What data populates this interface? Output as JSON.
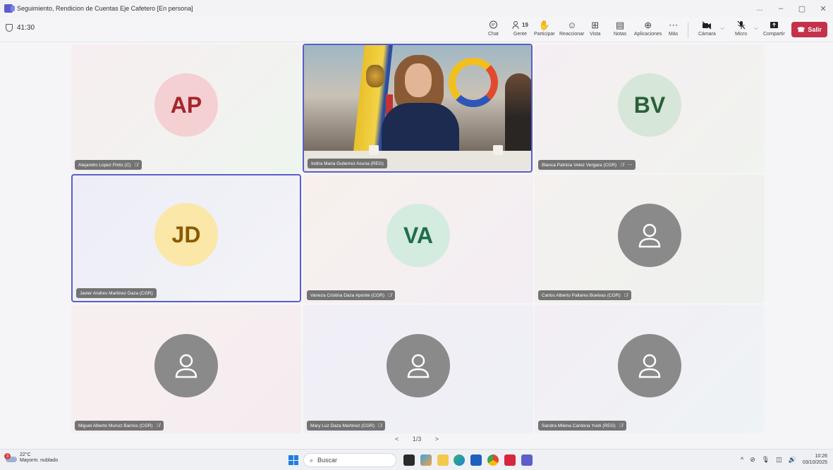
{
  "window": {
    "title": "Seguimiento, Rendicion de Cuentas Eje Cafetero [En persona]",
    "controls": [
      "...",
      "–",
      "▢",
      "✕"
    ]
  },
  "meeting": {
    "timer": "41:30",
    "toolbar": {
      "chat": "Chat",
      "people": "Gente",
      "people_count": "19",
      "raise": "Participar",
      "react": "Reaccionar",
      "view": "Vista",
      "notes": "Notas",
      "apps": "Aplicaciones",
      "more": "Más",
      "camera": "Cámara",
      "mic": "Micro",
      "share": "Compartir",
      "leave": "Salir"
    },
    "leave_color": "#c4314b",
    "accent_color": "#5b5fc7"
  },
  "participants": [
    {
      "name": "Alejandro Lopez Pinto (C)",
      "initials": "AP",
      "avatar_bg": "#f4d0d3",
      "avatar_fg": "#a4262c",
      "tile_bg": "linear-gradient(135deg,#f7eef0,#eef5ef)",
      "muted": true
    },
    {
      "name": "Indira Maria Gutierrez Acuna (REG)",
      "initials": "",
      "video": true,
      "muted": false
    },
    {
      "name": "Blanca Patricia Velez Vergara (CGR)",
      "initials": "BV",
      "avatar_bg": "#d6e6d8",
      "avatar_fg": "#2a5f3a",
      "tile_bg": "linear-gradient(135deg,#f5eef2,#f0f3ee)",
      "muted": true
    },
    {
      "name": "Javier Andres Martinez Daza (CGR)",
      "initials": "JD",
      "avatar_bg": "#fbe7a8",
      "avatar_fg": "#8a5a00",
      "tile_bg": "linear-gradient(135deg,#ecedf7,#f3f3f7)",
      "muted": false
    },
    {
      "name": "Vaneza Cristina Daza Aponte (CGR)",
      "initials": "VA",
      "avatar_bg": "#d3ecdf",
      "avatar_fg": "#1f6e4a",
      "tile_bg": "linear-gradient(135deg,#f7f0ec,#f3eef4)",
      "muted": true
    },
    {
      "name": "Carlos Alberto Pallares Buelvas (CGR)",
      "initials": "",
      "tile_bg": "linear-gradient(135deg,#f4f1ef,#eef1ee)",
      "muted": true
    },
    {
      "name": "Miguel Alberto Munoz Barrios (CGR)",
      "initials": "",
      "tile_bg": "linear-gradient(135deg,#f7efef,#f4ecef)",
      "muted": true
    },
    {
      "name": "Mary Luz Daza Martinez (CGR)",
      "initials": "",
      "tile_bg": "linear-gradient(135deg,#f1eef6,#eef0f5)",
      "muted": true
    },
    {
      "name": "Sandra Milena Cardona Yusti (REG)",
      "initials": "",
      "tile_bg": "linear-gradient(135deg,#f3eef4,#eef3f5)",
      "muted": true
    }
  ],
  "pager": {
    "prev": "<",
    "label": "1/3",
    "next": ">"
  },
  "taskbar": {
    "weather_badge": "3",
    "temperature": "22°C",
    "condition": "Mayorm. nublado",
    "search_placeholder": "Buscar",
    "time": "10:26",
    "date": "03/10/2025"
  }
}
